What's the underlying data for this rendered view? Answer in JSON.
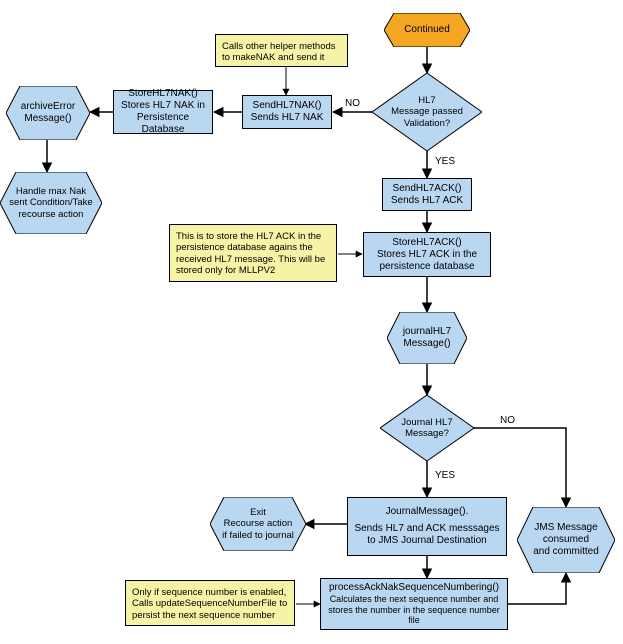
{
  "chart_data": {
    "type": "flowchart",
    "nodes": [
      {
        "id": "continued",
        "kind": "terminator",
        "label": "Continued"
      },
      {
        "id": "d_hl7pass",
        "kind": "decision",
        "label": "HL7 Message passed Validation?"
      },
      {
        "id": "p_sendnak",
        "kind": "process",
        "label": "SendHL7NAK() Sends HL7 NAK"
      },
      {
        "id": "n_helpers",
        "kind": "note",
        "label": "Calls other helper methods to makeNAK and send it"
      },
      {
        "id": "p_storenak",
        "kind": "process",
        "label": "StoreHL7NAK() Stores HL7 NAK in Persistence Database"
      },
      {
        "id": "h_archive",
        "kind": "preparation",
        "label": "archiveError Message()"
      },
      {
        "id": "h_maxnak",
        "kind": "preparation",
        "label": "Handle max Nak sent Condition/Take recourse action"
      },
      {
        "id": "p_sendack",
        "kind": "process",
        "label": "SendHL7ACK() Sends HL7 ACK"
      },
      {
        "id": "p_storeack",
        "kind": "process",
        "label": "StoreHL7ACK() Stores HL7 ACK in the persistence database"
      },
      {
        "id": "n_storeack",
        "kind": "note",
        "label": "This is to store the HL7 ACK in the persistence database agains the received HL7 message. This will be stored only for MLLPV2"
      },
      {
        "id": "h_journal",
        "kind": "preparation",
        "label": "journalHL7 Message()"
      },
      {
        "id": "d_journal",
        "kind": "decision",
        "label": "Journal HL7 Message?"
      },
      {
        "id": "p_journalmsg",
        "kind": "process",
        "label": "JournalMessage(). Sends HL7 and ACK messsages to JMS Journal Destination"
      },
      {
        "id": "h_exit",
        "kind": "preparation",
        "label": "Exit Recourse action if failed to journal"
      },
      {
        "id": "p_seq",
        "kind": "process",
        "label": "processAckNakSequenceNumbering() Calculates the next sequence number and stores the number in the sequence number file"
      },
      {
        "id": "n_seq",
        "kind": "note",
        "label": "Only if sequence number is enabled, Calls updateSequenceNumberFile to persist the next sequence number"
      },
      {
        "id": "h_jms",
        "kind": "preparation",
        "label": "JMS Message consumed and committed"
      }
    ],
    "edges": [
      {
        "from": "continued",
        "to": "d_hl7pass"
      },
      {
        "from": "d_hl7pass",
        "to": "p_sendnak",
        "label": "NO"
      },
      {
        "from": "d_hl7pass",
        "to": "p_sendack",
        "label": "YES"
      },
      {
        "from": "p_sendnak",
        "to": "p_storenak"
      },
      {
        "from": "p_storenak",
        "to": "h_archive"
      },
      {
        "from": "h_archive",
        "to": "h_maxnak"
      },
      {
        "from": "p_sendack",
        "to": "p_storeack"
      },
      {
        "from": "p_storeack",
        "to": "h_journal"
      },
      {
        "from": "h_journal",
        "to": "d_journal"
      },
      {
        "from": "d_journal",
        "to": "p_journalmsg",
        "label": "YES"
      },
      {
        "from": "d_journal",
        "to": "h_jms",
        "label": "NO"
      },
      {
        "from": "p_journalmsg",
        "to": "h_exit"
      },
      {
        "from": "p_journalmsg",
        "to": "p_seq"
      },
      {
        "from": "p_seq",
        "to": "h_jms"
      },
      {
        "from": "n_helpers",
        "to": "p_sendnak",
        "kind": "note-link"
      },
      {
        "from": "n_storeack",
        "to": "p_storeack",
        "kind": "note-link"
      },
      {
        "from": "n_seq",
        "to": "p_seq",
        "kind": "note-link"
      }
    ]
  },
  "labels": {
    "continued": "Continued",
    "d_hl7pass": "HL7\nMessage passed\nValidation?",
    "p_sendnak_l1": "SendHL7NAK()",
    "p_sendnak_l2": "Sends HL7 NAK",
    "n_helpers": "Calls other helper methods to makeNAK and send it",
    "p_storenak_l1": "StoreHL7NAK()",
    "p_storenak_l2": "Stores HL7 NAK in Persistence Database",
    "h_archive": "archiveError\nMessage()",
    "h_maxnak": "Handle max Nak\nsent Condition/Take\nrecourse action",
    "p_sendack_l1": "SendHL7ACK()",
    "p_sendack_l2": "Sends HL7 ACK",
    "p_storeack_l1": "StoreHL7ACK()",
    "p_storeack_l2": "Stores HL7 ACK in the persistence database",
    "n_storeack": "This is to store the HL7 ACK in the persistence database agains the received HL7 message. This will be stored only for MLLPV2",
    "h_journal": "journalHL7\nMessage()",
    "d_journal": "Journal HL7\nMessage?",
    "p_journalmsg_l1": "JournalMessage().",
    "p_journalmsg_l2": "Sends HL7 and ACK messsages to JMS Journal Destination",
    "h_exit": "Exit\nRecourse action\nif failed to journal",
    "p_seq_l1": "processAckNakSequenceNumbering()",
    "p_seq_l2": "Calculates the next sequence number and stores the number in the sequence number file",
    "n_seq": "Only if sequence number is enabled, Calls updateSequenceNumberFile to persist the next sequence number",
    "h_jms": "JMS Message\nconsumed\nand committed",
    "edge_no": "NO",
    "edge_yes": "YES"
  },
  "colors": {
    "process_fill": "#bad7f2",
    "note_fill": "#f6f3a6",
    "terminator_fill": "#f5a623",
    "stroke": "#000000"
  }
}
